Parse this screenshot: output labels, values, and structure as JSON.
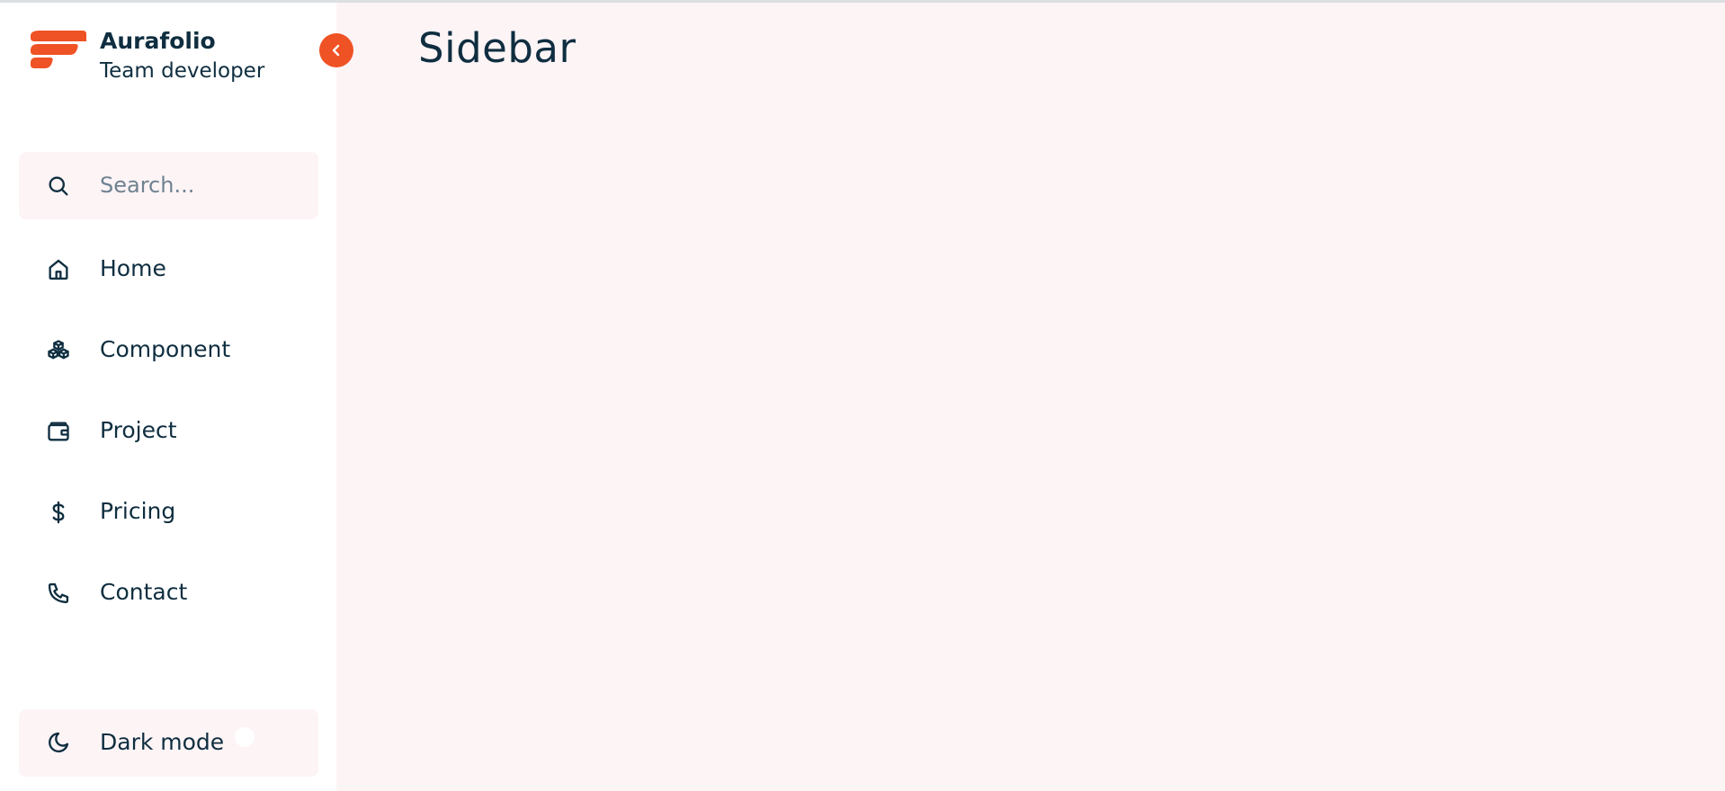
{
  "brand": {
    "name": "Aurafolio",
    "subtitle": "Team developer"
  },
  "search": {
    "placeholder": "Search..."
  },
  "nav": {
    "items": [
      {
        "label": "Home",
        "icon": "home-icon"
      },
      {
        "label": "Component",
        "icon": "cubes-icon"
      },
      {
        "label": "Project",
        "icon": "wallet-icon"
      },
      {
        "label": "Pricing",
        "icon": "dollar-icon"
      },
      {
        "label": "Contact",
        "icon": "phone-icon"
      }
    ]
  },
  "dark_mode": {
    "label": "Dark mode",
    "icon": "moon-icon"
  },
  "main": {
    "title": "Sidebar"
  },
  "colors": {
    "accent": "#ef5224",
    "text": "#0f2e40",
    "background": "#fdf4f6"
  }
}
